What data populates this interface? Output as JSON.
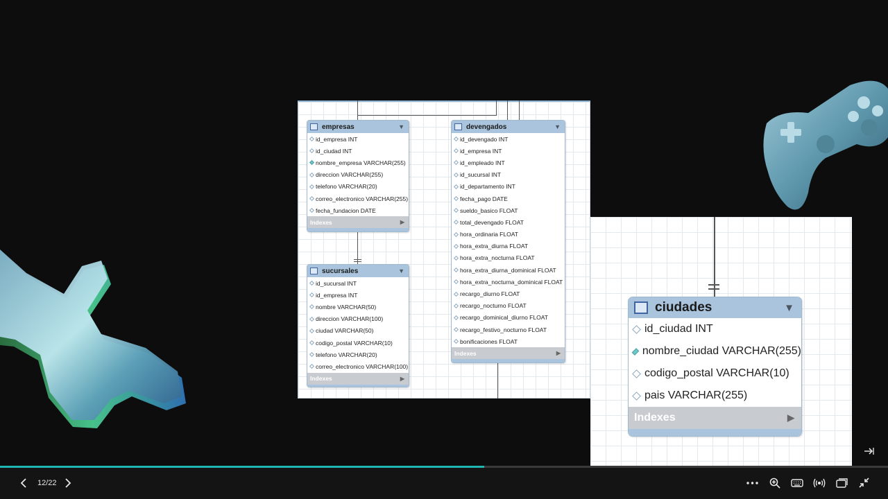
{
  "slide": {
    "counter": "12/22",
    "progress_fraction": 0.545
  },
  "diagram": {
    "indexes_label": "Indexes",
    "tables": {
      "empresas": {
        "name": "empresas",
        "columns": [
          {
            "text": "id_empresa INT",
            "fk": false
          },
          {
            "text": "id_ciudad INT",
            "fk": false
          },
          {
            "text": "nombre_empresa VARCHAR(255)",
            "fk": true
          },
          {
            "text": "direccion VARCHAR(255)",
            "fk": false
          },
          {
            "text": "telefono VARCHAR(20)",
            "fk": false
          },
          {
            "text": "correo_electronico VARCHAR(255)",
            "fk": false
          },
          {
            "text": "fecha_fundacion DATE",
            "fk": false
          }
        ]
      },
      "sucursales": {
        "name": "sucursales",
        "columns": [
          {
            "text": "id_sucursal INT",
            "fk": false
          },
          {
            "text": "id_empresa INT",
            "fk": false
          },
          {
            "text": "nombre VARCHAR(50)",
            "fk": false
          },
          {
            "text": "direccion VARCHAR(100)",
            "fk": false
          },
          {
            "text": "ciudad VARCHAR(50)",
            "fk": false
          },
          {
            "text": "codigo_postal VARCHAR(10)",
            "fk": false
          },
          {
            "text": "telefono VARCHAR(20)",
            "fk": false
          },
          {
            "text": "correo_electronico VARCHAR(100)",
            "fk": false
          }
        ]
      },
      "devengados": {
        "name": "devengados",
        "columns": [
          {
            "text": "id_devengado INT",
            "fk": false
          },
          {
            "text": "id_empresa INT",
            "fk": false
          },
          {
            "text": "id_empleado INT",
            "fk": false
          },
          {
            "text": "id_sucursal INT",
            "fk": false
          },
          {
            "text": "id_departamento INT",
            "fk": false
          },
          {
            "text": "fecha_pago DATE",
            "fk": false
          },
          {
            "text": "sueldo_basico FLOAT",
            "fk": false
          },
          {
            "text": "total_devengado FLOAT",
            "fk": false
          },
          {
            "text": "hora_ordinaria FLOAT",
            "fk": false
          },
          {
            "text": "hora_extra_diurna FLOAT",
            "fk": false
          },
          {
            "text": "hora_extra_nocturna FLOAT",
            "fk": false
          },
          {
            "text": "hora_extra_diurna_dominical FLOAT",
            "fk": false
          },
          {
            "text": "hora_extra_nocturna_dominical FLOAT",
            "fk": false
          },
          {
            "text": "recargo_diurno FLOAT",
            "fk": false
          },
          {
            "text": "recargo_nocturno FLOAT",
            "fk": false
          },
          {
            "text": "recargo_dominical_diurno FLOAT",
            "fk": false
          },
          {
            "text": "recargo_festivo_nocturno FLOAT",
            "fk": false
          },
          {
            "text": "bonificaciones FLOAT",
            "fk": false
          }
        ]
      },
      "ciudades": {
        "name": "ciudades",
        "columns": [
          {
            "text": "id_ciudad INT",
            "fk": false
          },
          {
            "text": "nombre_ciudad VARCHAR(255)",
            "fk": true
          },
          {
            "text": "codigo_postal VARCHAR(10)",
            "fk": false
          },
          {
            "text": "pais VARCHAR(255)",
            "fk": false
          }
        ]
      }
    }
  },
  "icons": {
    "prev": "chevron-left-icon",
    "next": "chevron-right-icon",
    "more": "more-horizontal-icon",
    "zoom": "zoom-in-icon",
    "keyboard": "keyboard-icon",
    "broadcast": "broadcast-icon",
    "pip": "picture-in-picture-icon",
    "exit_fullscreen": "exit-fullscreen-icon",
    "side_arrow": "arrow-right-icon"
  },
  "colors": {
    "accent": "#1fb5b0",
    "table_header": "#a9c4dc",
    "fk_marker": "#6fc7c9"
  }
}
